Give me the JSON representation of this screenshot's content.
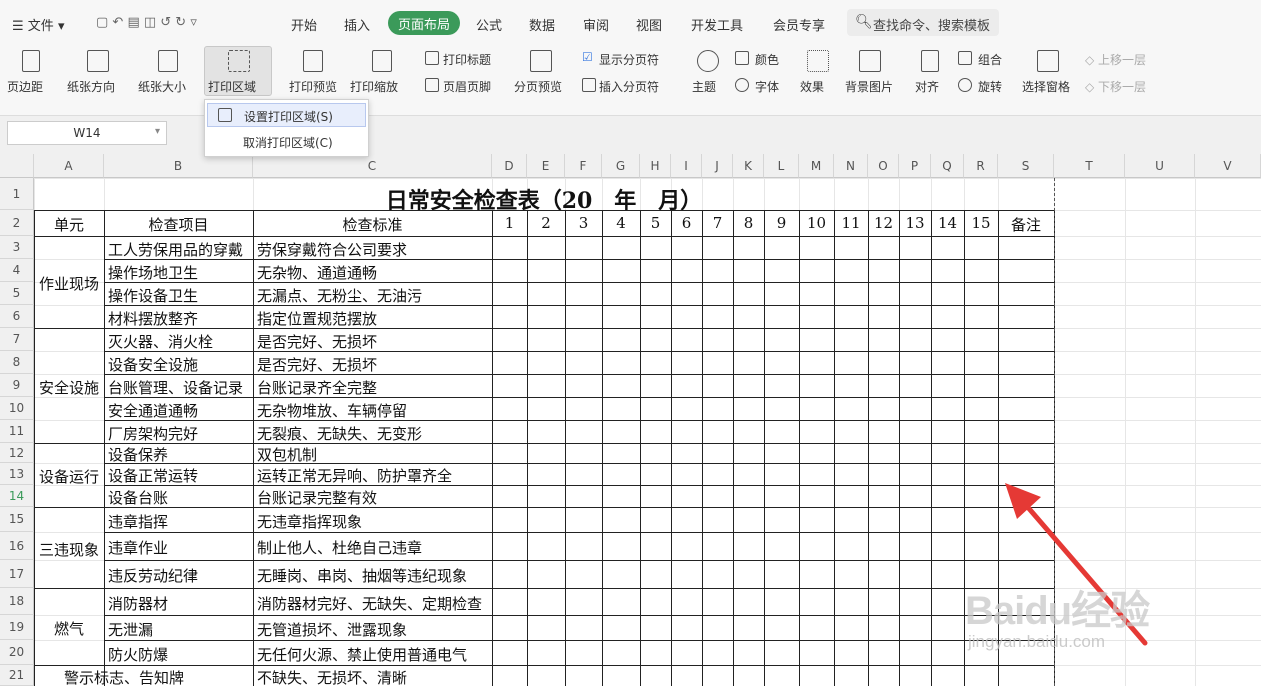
{
  "menubar": {
    "file_label": "文件",
    "tabs": [
      "开始",
      "插入",
      "页面布局",
      "公式",
      "数据",
      "审阅",
      "视图",
      "开发工具",
      "会员专享"
    ],
    "active_tab": "页面布局",
    "search_placeholder": "查找命令、搜索模板"
  },
  "ribbon": {
    "margins": "页边距",
    "orientation": "纸张方向",
    "size": "纸张大小",
    "print_area": "打印区域",
    "print_preview": "打印预览",
    "print_scale": "打印缩放",
    "print_titles": "打印标题",
    "header_footer": "页眉页脚",
    "page_break_preview": "分页预览",
    "show_page_breaks": "显示分页符",
    "insert_page_break": "插入分页符",
    "theme": "主题",
    "colors": "颜色",
    "fonts": "字体",
    "effects": "效果",
    "background": "背景图片",
    "align": "对齐",
    "group": "组合",
    "rotate": "旋转",
    "selection_pane": "选择窗格",
    "bring_forward": "上移一层",
    "send_backward": "下移一层"
  },
  "dropdown": {
    "set_print_area": "设置打印区域(S)",
    "clear_print_area": "取消打印区域(C)"
  },
  "namebox": "W14",
  "columns": [
    "A",
    "B",
    "C",
    "D",
    "E",
    "F",
    "G",
    "H",
    "I",
    "J",
    "K",
    "L",
    "M",
    "N",
    "O",
    "P",
    "Q",
    "R",
    "S",
    "T",
    "U",
    "V"
  ],
  "rows": [
    "1",
    "2",
    "3",
    "4",
    "5",
    "6",
    "7",
    "8",
    "9",
    "10",
    "11",
    "12",
    "13",
    "14",
    "15",
    "16",
    "17",
    "18",
    "19",
    "20",
    "21"
  ],
  "sheet": {
    "title": "日常安全检查表（20__年__月）",
    "header": {
      "unit": "单元",
      "item": "检查项目",
      "standard": "检查标准",
      "days": [
        "1",
        "2",
        "3",
        "4",
        "5",
        "6",
        "7",
        "8",
        "9",
        "10",
        "11",
        "12",
        "13",
        "14",
        "15"
      ],
      "note": "备注"
    },
    "groups": [
      {
        "unit": "作业现场",
        "items": [
          {
            "item": "工人劳保用品的穿戴",
            "standard": "劳保穿戴符合公司要求"
          },
          {
            "item": "操作场地卫生",
            "standard": "无杂物、通道通畅"
          },
          {
            "item": "操作设备卫生",
            "standard": "无漏点、无粉尘、无油污"
          },
          {
            "item": "材料摆放整齐",
            "standard": "指定位置规范摆放"
          }
        ]
      },
      {
        "unit": "安全设施",
        "items": [
          {
            "item": "灭火器、消火栓",
            "standard": "是否完好、无损坏"
          },
          {
            "item": "设备安全设施",
            "standard": "是否完好、无损坏"
          },
          {
            "item": "台账管理、设备记录",
            "standard": "台账记录齐全完整"
          },
          {
            "item": "安全通道通畅",
            "standard": "无杂物堆放、车辆停留"
          },
          {
            "item": "厂房架构完好",
            "standard": "无裂痕、无缺失、无变形"
          }
        ]
      },
      {
        "unit": "设备运行",
        "items": [
          {
            "item": "设备保养",
            "standard": "双包机制"
          },
          {
            "item": "设备正常运转",
            "standard": "运转正常无异响、防护罩齐全"
          },
          {
            "item": "设备台账",
            "standard": "台账记录完整有效"
          }
        ]
      },
      {
        "unit": "三违现象",
        "items": [
          {
            "item": "违章指挥",
            "standard": "无违章指挥现象"
          },
          {
            "item": "违章作业",
            "standard": "制止他人、杜绝自己违章"
          },
          {
            "item": "违反劳动纪律",
            "standard": "无睡岗、串岗、抽烟等违纪现象"
          }
        ]
      },
      {
        "unit": "燃气",
        "items": [
          {
            "item": "消防器材",
            "standard": "消防器材完好、无缺失、定期检查"
          },
          {
            "item": "无泄漏",
            "standard": "无管道损坏、泄露现象"
          },
          {
            "item": "防火防爆",
            "standard": "无任何火源、禁止使用普通电气"
          }
        ]
      },
      {
        "unit": "警示标志、告知牌",
        "items": [
          {
            "item": "",
            "standard": "不缺失、无损坏、清晰"
          }
        ]
      }
    ]
  },
  "watermark": {
    "brand": "Baidu经验",
    "url": "jingyan.baidu.com"
  },
  "colors": {
    "accent": "#3b9a5a",
    "arrow": "#e53935"
  }
}
